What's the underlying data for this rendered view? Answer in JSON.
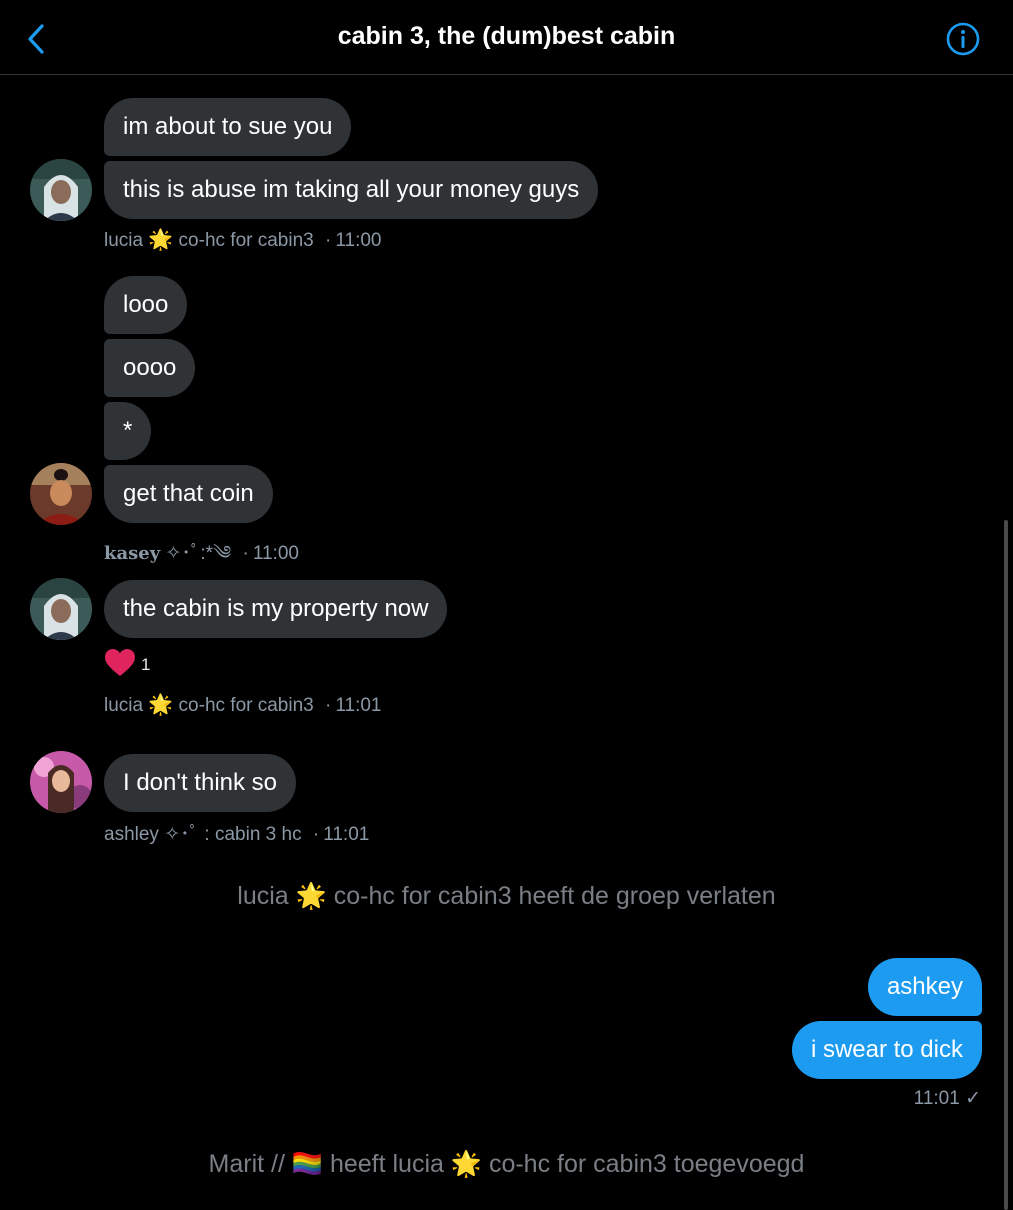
{
  "header": {
    "title": "cabin 3, the (dum)best cabin",
    "accent": "#1d9bf0"
  },
  "messages": {
    "m1": "im about to sue you",
    "m2": "this is abuse im taking all your money guys",
    "meta1": {
      "name": "lucia",
      "role": "co-hc for cabin3",
      "time": "11:00",
      "star": "🌟"
    },
    "m3": "looo",
    "m4": "oooo",
    "m5": "*",
    "m6": "get that coin",
    "meta2": {
      "name": "kasey",
      "deco": "✧･ﾟ:*༄",
      "time": "11:00"
    },
    "m7": "the cabin is my property now",
    "reaction": {
      "icon": "heart-icon",
      "count": "1"
    },
    "meta3": {
      "name": "lucia",
      "role": "co-hc for cabin3",
      "time": "11:01",
      "star": "🌟"
    },
    "m8": "I don't think so",
    "meta4": {
      "name": "ashley",
      "deco": "✧･ﾟ",
      "role": ": cabin 3 hc",
      "time": "11:01"
    },
    "system1": "lucia 🌟 co-hc for cabin3 heeft de groep verlaten",
    "out1": "ashkey",
    "out2": "i swear to dick",
    "out_time": "11:01 ✓",
    "system2": "Marit // 🏳️‍🌈 heeft lucia 🌟 co-hc for cabin3 toegevoegd"
  }
}
